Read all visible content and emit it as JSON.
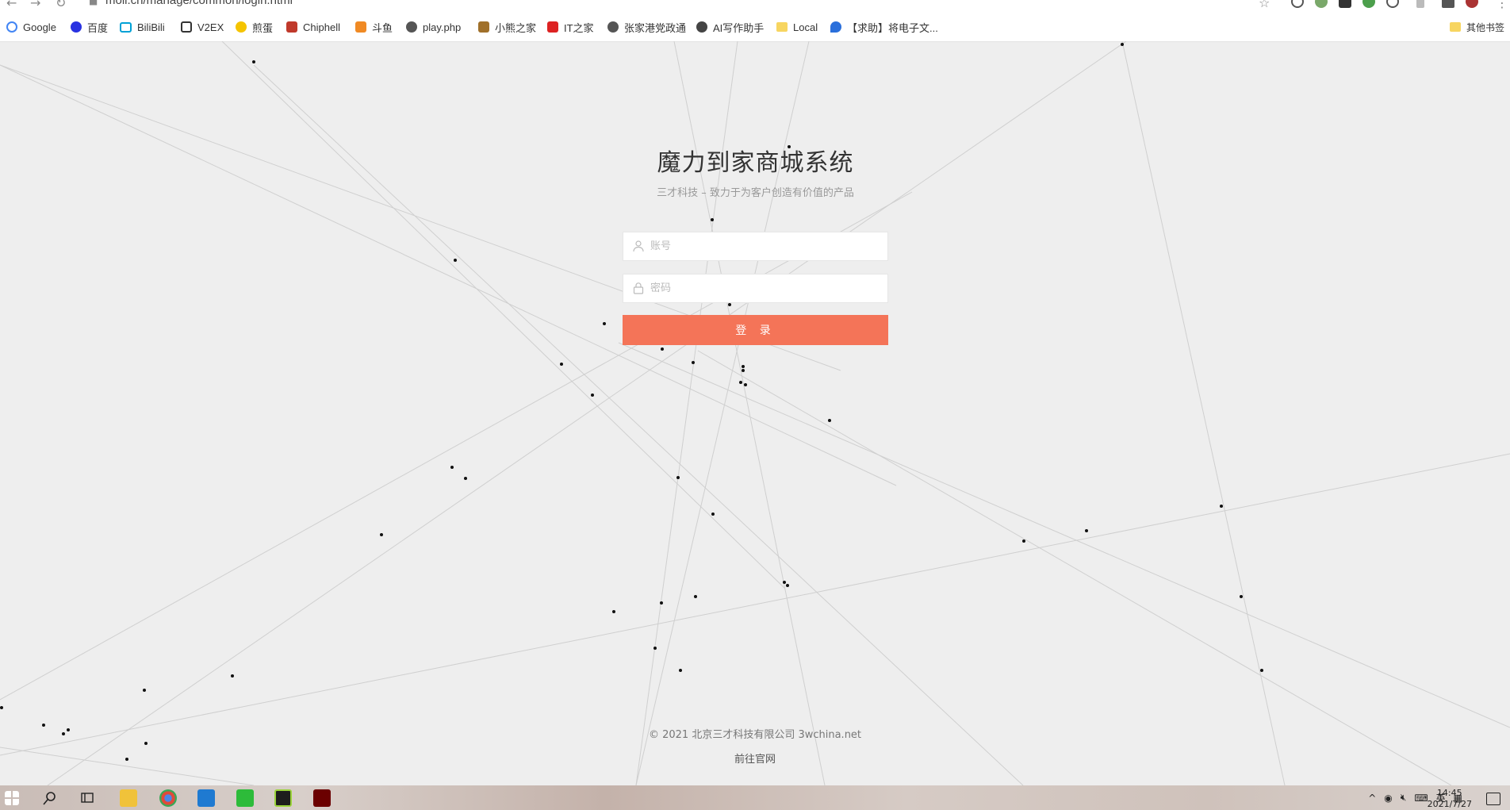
{
  "browser": {
    "url": "moli.cn/manage/common/login.html",
    "bookmarks": [
      {
        "label": "Google",
        "icon": "google-icon"
      },
      {
        "label": "百度",
        "icon": "baidu-icon"
      },
      {
        "label": "BiliBili",
        "icon": "bilibili-icon"
      },
      {
        "label": "V2EX",
        "icon": "v2ex-icon"
      },
      {
        "label": "煎蛋",
        "icon": "jandan-icon"
      },
      {
        "label": "Chiphell",
        "icon": "chiphell-icon"
      },
      {
        "label": "斗鱼",
        "icon": "douyu-icon"
      },
      {
        "label": "play.php",
        "icon": "globe-icon"
      },
      {
        "label": "小熊之家",
        "icon": "bear-icon"
      },
      {
        "label": "IT之家",
        "icon": "ithome-icon"
      },
      {
        "label": "张家港党政通",
        "icon": "globe-icon"
      },
      {
        "label": "AI写作助手",
        "icon": "ai-writer-icon"
      },
      {
        "label": "Local",
        "icon": "folder-icon"
      },
      {
        "label": "【求助】将电子文...",
        "icon": "drop-icon"
      }
    ],
    "other_bookmarks": "其他书签"
  },
  "login": {
    "title": "魔力到家商城系统",
    "subtitle": "三才科技 – 致力于为客户创造有价值的产品",
    "username_placeholder": "账号",
    "password_placeholder": "密码",
    "submit_label": "登 录"
  },
  "footer": {
    "copyright": "© 2021  北京三才科技有限公司 3wchina.net",
    "link": "前往官网"
  },
  "taskbar": {
    "ime": "英",
    "time": "14:45",
    "date": "2021/7/27"
  },
  "colors": {
    "accent": "#f47458",
    "background": "#eeeeee"
  }
}
